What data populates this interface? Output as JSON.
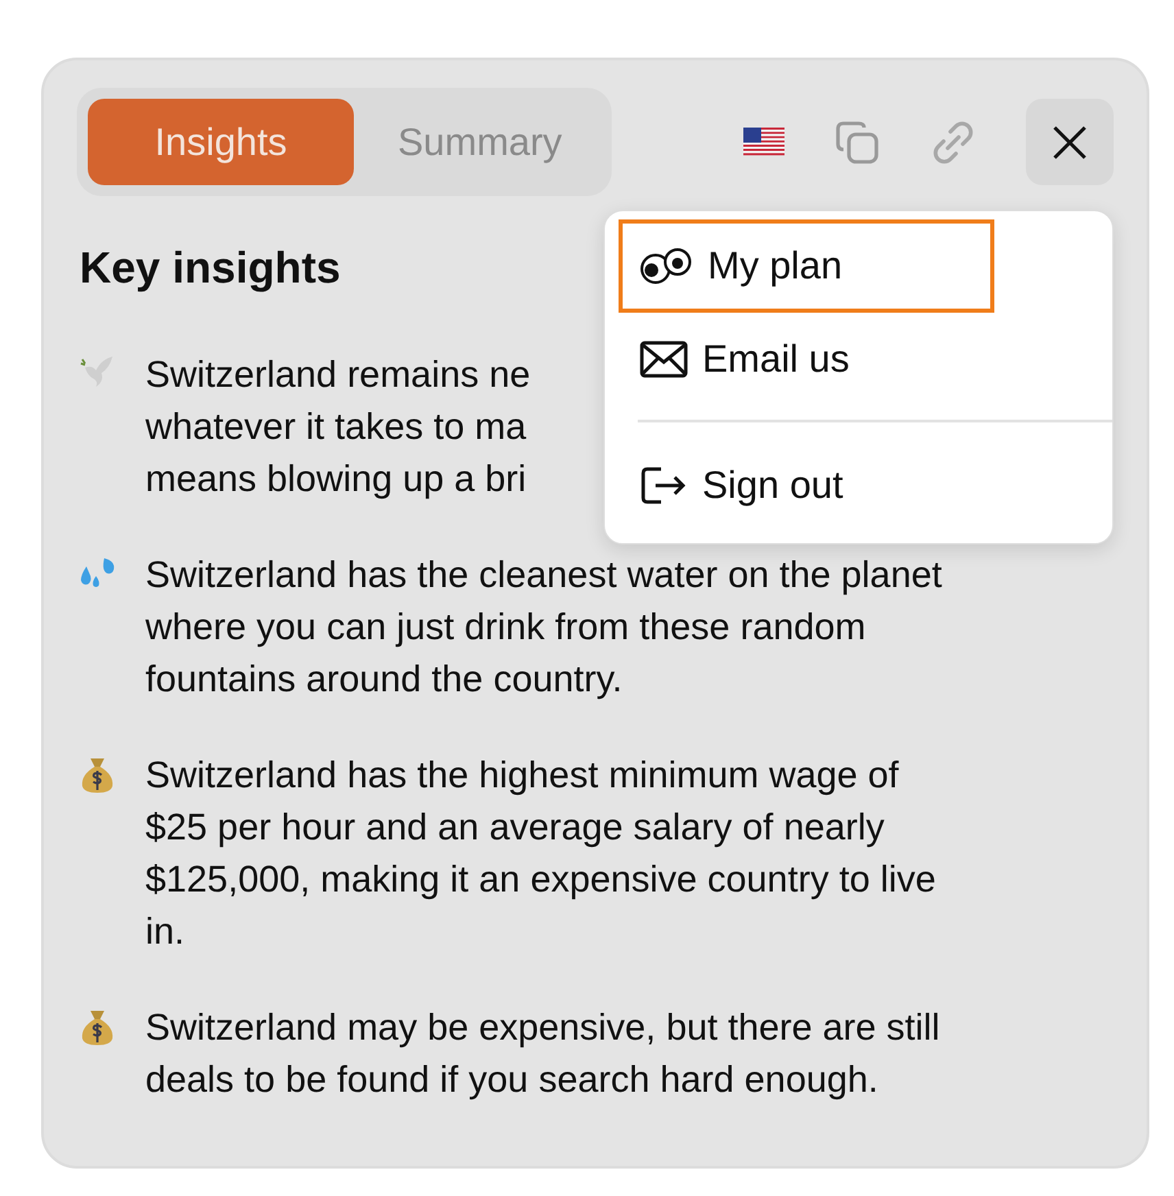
{
  "tabs": [
    {
      "label": "Insights",
      "selected": true
    },
    {
      "label": "Summary",
      "selected": false
    }
  ],
  "heading": "Key insights",
  "insights": [
    {
      "kind": "dove",
      "lines": [
        "Switzerland remains ne",
        "whatever it takes to ma",
        "means blowing up a bri"
      ]
    },
    {
      "kind": "droplets",
      "lines": [
        "Switzerland has the cleanest water on the planet",
        "where you can just drink from these random",
        "fountains around the country."
      ]
    },
    {
      "kind": "money",
      "lines": [
        "Switzerland has the highest minimum wage of",
        "$25 per hour and an average salary of nearly",
        "$125,000, making it an expensive country to live",
        "in."
      ]
    },
    {
      "kind": "money",
      "lines": [
        "Switzerland may be expensive, but there are still",
        "deals to be found if you search hard enough."
      ]
    }
  ],
  "menu": {
    "items": [
      {
        "kind": "eyes",
        "label": "My plan",
        "selected": true
      },
      {
        "kind": "mail",
        "label": "Email us",
        "selected": false
      },
      {
        "kind": "signout",
        "label": "Sign out",
        "selected": false
      }
    ]
  }
}
